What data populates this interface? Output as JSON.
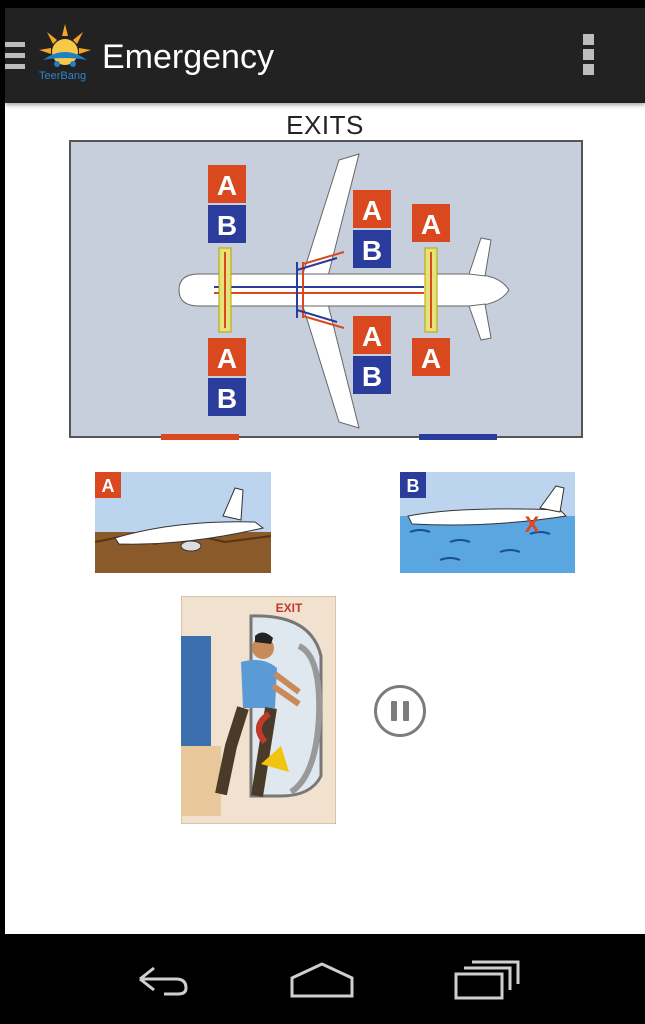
{
  "app": {
    "title": "Emergency",
    "logo_text": "TeerBang"
  },
  "page": {
    "section_title": "EXITS"
  },
  "diagram": {
    "labels": {
      "upper_left_a": "A",
      "upper_left_b": "B",
      "upper_mid_a": "A",
      "upper_mid_b": "B",
      "upper_right_a": "A",
      "lower_left_a": "A",
      "lower_left_b": "B",
      "lower_mid_a": "A",
      "lower_mid_b": "B",
      "lower_right_a": "A"
    }
  },
  "thumbs": {
    "land_label": "A",
    "water_label": "B"
  },
  "illustration": {
    "exit_sign": "EXIT"
  },
  "colors": {
    "action_bar": "#222222",
    "badge_a": "#d9481f",
    "badge_b": "#2a3c9c",
    "sky": "#bcd4ee",
    "ground": "#8a5a2b",
    "water": "#5aa6e0"
  },
  "icons": {
    "drawer": "menu-icon",
    "overflow": "more-vert-icon",
    "media": "pause-icon",
    "back": "back-icon",
    "home": "home-icon",
    "recents": "recents-icon"
  }
}
